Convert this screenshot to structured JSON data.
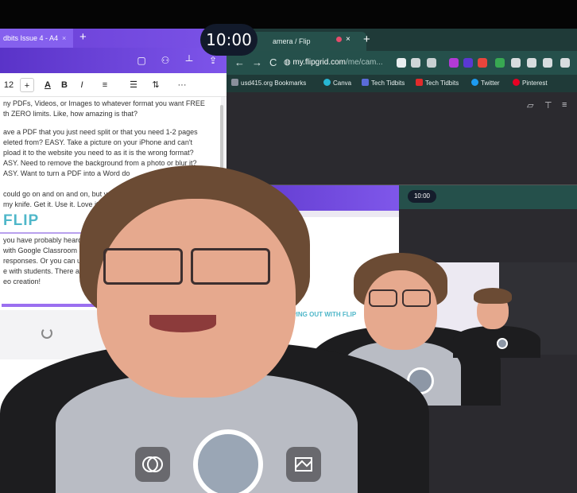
{
  "clock": {
    "time": "10:00"
  },
  "left_window": {
    "tab_title": "dbits Issue 4 - A4",
    "tab_close": "×",
    "tab_add": "+",
    "toolbar": {
      "font_size": "12",
      "increase": "+",
      "text_color": "A",
      "bold": "B",
      "italic": "I",
      "more": "···"
    },
    "doc": {
      "para1": "ny PDFs, Videos, or Images to whatever format you want FREE\nth ZERO limits. Like, how amazing is that?",
      "para2": "ave a PDF that you just need split or that you need 1-2 pages\neleted from? EASY. Take a picture on your iPhone and can't\npload it to the website you need to as it is the wrong format?\nASY. Need to remove the background from a photo or blur it?\nASY. Want to turn a PDF into a Word do",
      "para3": " could go on and on and on, but yo\n my knife. Get it. Use it. Love it.",
      "flip_heading": "FLIP",
      "para4": " you have probably heard of\n with Google Classroom and\n responses. Or you can use\ne with students. There are\neo creation!"
    }
  },
  "right_window": {
    "tab_title": "amera / Flip",
    "tab_close": "×",
    "tab_add": "+",
    "url_host": "my.flipgrid.com",
    "url_path": "/me/cam...",
    "nav": {
      "back": "←",
      "forward": "→",
      "reload": "C"
    },
    "bookmarks": [
      {
        "label": "usd415.org Bookmarks",
        "color": "#8a8f9b"
      },
      {
        "label": "Canva",
        "color": "#27b7d4"
      },
      {
        "label": "Tech Tidbits",
        "color": "#5a6bd8"
      },
      {
        "label": "Tech Tidbits",
        "color": "#e02b2b"
      },
      {
        "label": "Twitter",
        "color": "#1d9bf0"
      },
      {
        "label": "Pinterest",
        "color": "#e60023"
      }
    ]
  },
  "mirror": {
    "time": "10:00",
    "heading": "FLIPPING OUT WITH FLIP"
  },
  "colors": {
    "canva_purple": "#7a52e6",
    "browser_teal": "#25504b",
    "flip_teal": "#4fb7c9",
    "record_ring": "#ffffff"
  },
  "icons": {
    "effects": "effects-icon",
    "record": "record-button",
    "background": "background-blur-icon"
  }
}
